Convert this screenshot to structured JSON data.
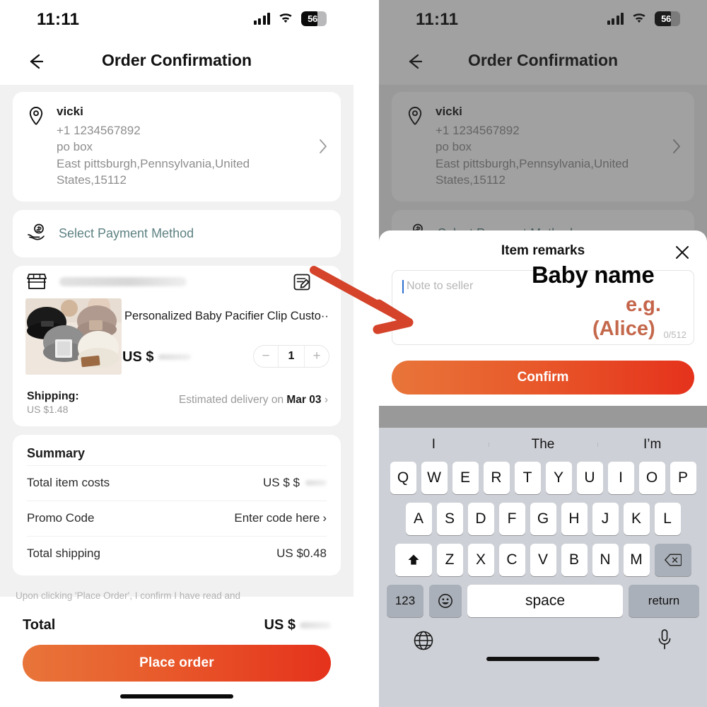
{
  "status_bar": {
    "time": "11:11",
    "battery_level": "56",
    "signal_icon": "cellular-signal-icon",
    "wifi_icon": "wifi-icon",
    "battery_icon": "battery-icon"
  },
  "nav": {
    "title": "Order Confirmation",
    "back_icon": "back-arrow-icon"
  },
  "address": {
    "pin_icon": "location-pin-icon",
    "name": "vicki",
    "phone": "+1 1234567892",
    "line1": "po box",
    "line2": "East pittsburgh,Pennsylvania,United",
    "line3": "States,15112",
    "chevron_icon": "chevron-right-icon"
  },
  "payment": {
    "icon": "payment-hand-coin-icon",
    "label": "Select Payment Method"
  },
  "product": {
    "shop_icon": "storefront-icon",
    "shop_name_redacted": "",
    "note_icon": "edit-note-icon",
    "title": "Personalized Baby Pacifier Clip Custo···",
    "price_currency": "US $",
    "price_redacted": "",
    "qty": "1",
    "minus_label": "−",
    "plus_label": "+",
    "image_alt": "knit-beanie-hats-thumbnail"
  },
  "shipping": {
    "label": "Shipping:",
    "cost": "US $1.48",
    "eta_prefix": "Estimated delivery on",
    "eta_date": "Mar 03",
    "chevron_icon": "chevron-right-icon"
  },
  "summary": {
    "heading": "Summary",
    "rows": [
      {
        "key": "Total item costs",
        "value": "US $ $",
        "redacted": true,
        "chevron": false
      },
      {
        "key": "Promo Code",
        "value": "Enter code here",
        "redacted": false,
        "chevron": true
      },
      {
        "key": "Total shipping",
        "value": "US $0.48",
        "redacted": false,
        "chevron": false
      }
    ]
  },
  "legal": "Upon clicking 'Place Order', I confirm I have read and",
  "bottom": {
    "total_label": "Total",
    "total_currency": "US $",
    "total_redacted": "",
    "place_order_label": "Place order"
  },
  "modal": {
    "title": "Item remarks",
    "close_icon": "close-x-icon",
    "note_placeholder": "Note to seller",
    "note_value": "",
    "counter": "0/512",
    "confirm_label": "Confirm"
  },
  "annotations": {
    "baby_name": "Baby name",
    "eg": "e.g.",
    "alice": "(Alice)",
    "arrow_icon": "red-arrow-annotation",
    "arrow_color": "#d4432a"
  },
  "keyboard": {
    "suggestions": [
      "I",
      "The",
      "I’m"
    ],
    "row1": [
      "Q",
      "W",
      "E",
      "R",
      "T",
      "Y",
      "U",
      "I",
      "O",
      "P"
    ],
    "row2": [
      "A",
      "S",
      "D",
      "F",
      "G",
      "H",
      "J",
      "K",
      "L"
    ],
    "row3": [
      "Z",
      "X",
      "C",
      "V",
      "B",
      "N",
      "M"
    ],
    "shift_icon": "shift-up-arrow-icon",
    "backspace_icon": "backspace-delete-icon",
    "numbers_label": "123",
    "emoji_icon": "emoji-smiley-icon",
    "space_label": "space",
    "return_label": "return",
    "globe_icon": "globe-language-icon",
    "mic_icon": "microphone-icon"
  },
  "colors": {
    "accent_start": "#e8753a",
    "accent_end": "#e5321c",
    "payment_text": "#5e8183",
    "annotation_red": "#c4644a",
    "page_bg": "#f1f1f1"
  }
}
